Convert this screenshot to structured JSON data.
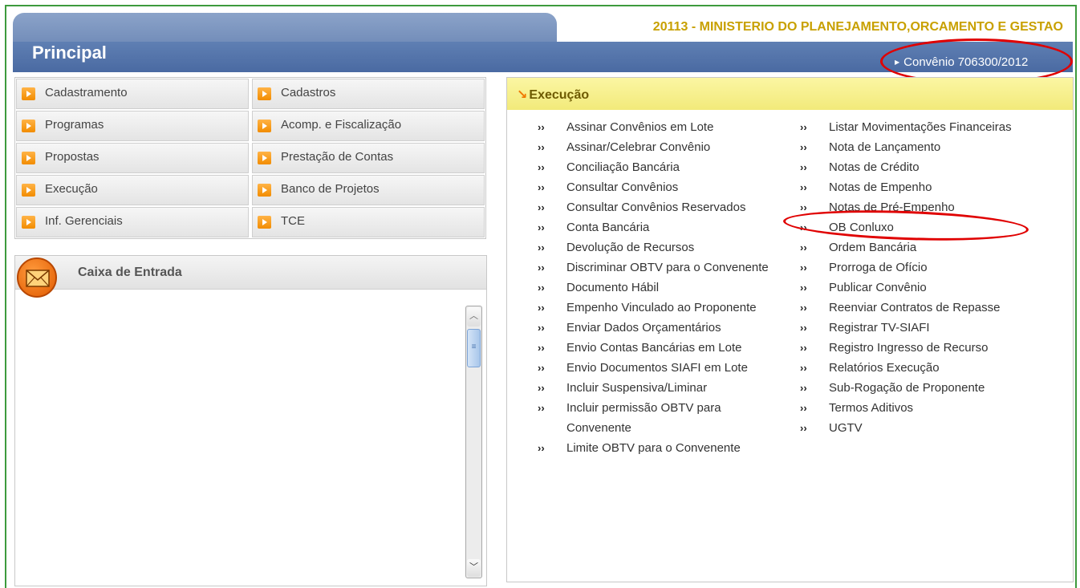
{
  "header": {
    "org_title": "20113 - MINISTERIO DO PLANEJAMENTO,ORCAMENTO E GESTAO",
    "page_title": "Principal",
    "convenio_link": "Convênio 706300/2012"
  },
  "menu": {
    "left": [
      {
        "label": "Cadastramento"
      },
      {
        "label": "Programas"
      },
      {
        "label": "Propostas"
      },
      {
        "label": "Execução"
      },
      {
        "label": "Inf. Gerenciais"
      }
    ],
    "right": [
      {
        "label": "Cadastros"
      },
      {
        "label": "Acomp. e Fiscalização"
      },
      {
        "label": "Prestação de Contas"
      },
      {
        "label": "Banco de Projetos"
      },
      {
        "label": "TCE"
      }
    ]
  },
  "inbox": {
    "title": "Caixa de Entrada"
  },
  "execucao": {
    "title": "Execução",
    "col1": [
      "Assinar Convênios em Lote",
      "Assinar/Celebrar Convênio",
      "Conciliação Bancária",
      "Consultar Convênios",
      "Consultar Convênios Reservados",
      "Conta Bancária",
      "Devolução de Recursos",
      "Discriminar OBTV para o Convenente",
      "Documento Hábil",
      "Empenho Vinculado ao Proponente",
      "Enviar Dados Orçamentários",
      "Envio Contas Bancárias em Lote",
      "Envio Documentos SIAFI em Lote",
      "Incluir Suspensiva/Liminar",
      "Incluir permissão OBTV para Convenente",
      "Limite OBTV para o Convenente"
    ],
    "col2": [
      "Listar Movimentações Financeiras",
      "Nota de Lançamento",
      "Notas de Crédito",
      "Notas de Empenho",
      "Notas de Pré-Empenho",
      "OB Conluxo",
      "Ordem Bancária",
      "Prorroga de Ofício",
      "Publicar Convênio",
      "Reenviar Contratos de Repasse",
      "Registrar TV-SIAFI",
      "Registro Ingresso de Recurso",
      "Relatórios Execução",
      "Sub-Rogação de Proponente",
      "Termos Aditivos",
      "UGTV"
    ]
  },
  "colors": {
    "header_blue": "#4a6aa2",
    "org_title": "#c8a000",
    "annotation": "#e00000",
    "exec_header": "#f2ea7a",
    "menu_bullet": "#f28c00"
  }
}
